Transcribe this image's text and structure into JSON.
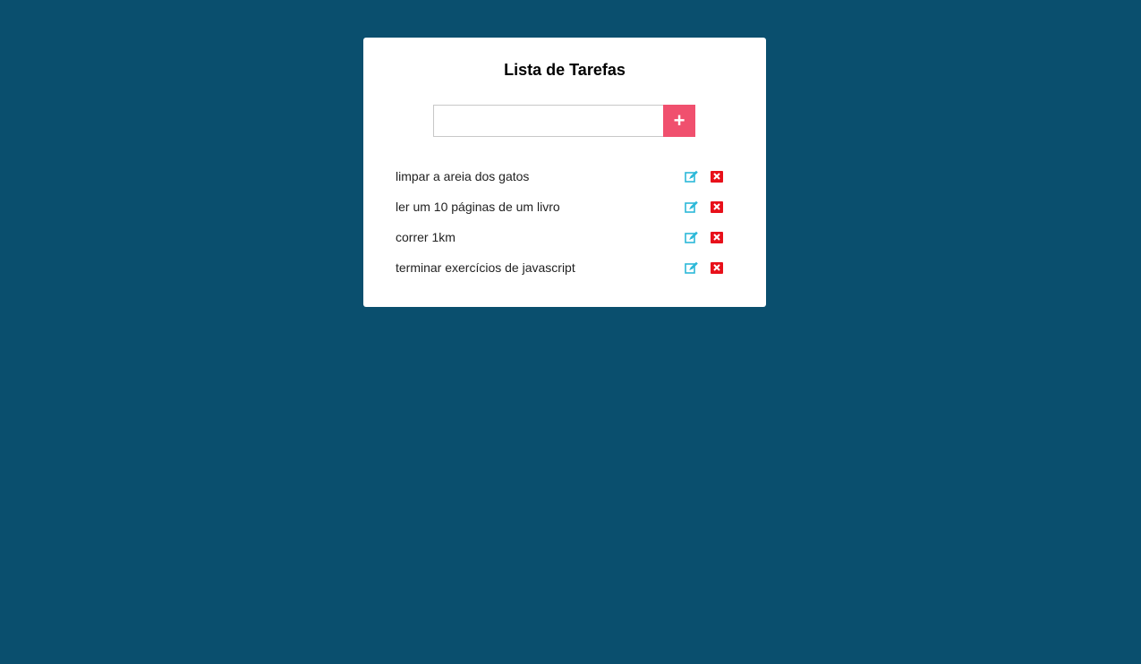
{
  "app": {
    "title": "Lista de Tarefas"
  },
  "input": {
    "value": "",
    "placeholder": "",
    "add_label": "+"
  },
  "tasks": [
    {
      "text": "limpar a areia dos gatos"
    },
    {
      "text": "ler um 10 páginas de um livro"
    },
    {
      "text": "correr 1km"
    },
    {
      "text": "terminar exercícios de javascript"
    }
  ],
  "icons": {
    "edit": "edit-icon",
    "delete": "delete-icon"
  },
  "colors": {
    "background": "#0a4f6e",
    "card": "#ffffff",
    "add_button": "#f0506e",
    "edit_icon": "#2bb8d8",
    "delete_icon": "#e8101a"
  }
}
